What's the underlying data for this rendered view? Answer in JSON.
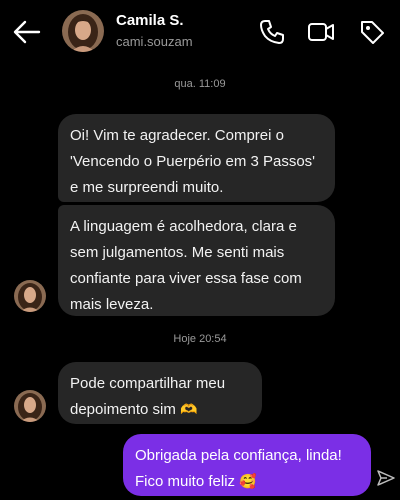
{
  "header": {
    "contact_name": "Camila S.",
    "username": "cami.souzam",
    "icons": [
      "back-arrow-icon",
      "phone-icon",
      "video-icon",
      "tag-icon"
    ]
  },
  "conversation": {
    "timestamp_1": "qua. 11:09",
    "messages_1": [
      {
        "from": "contact",
        "text": "Oi! Vim te agradecer. Comprei o 'Vencendo o Puerpério em 3 Passos' e me surpreendi muito."
      },
      {
        "from": "contact",
        "text": "A linguagem é acolhedora, clara e sem julgamentos. Me senti mais confiante para viver essa fase com mais leveza."
      }
    ],
    "timestamp_2": "Hoje 20:54",
    "messages_2": [
      {
        "from": "contact",
        "text": "Pode compartilhar meu depoimento sim",
        "emoji": "🫶"
      },
      {
        "from": "me",
        "text": "Obrigada pela confiança, linda! Fico muito feliz",
        "emoji": "🥰"
      }
    ]
  },
  "colors": {
    "background": "#000000",
    "incoming_bubble": "#262626",
    "outgoing_bubble": "#7b2fe6",
    "muted_text": "#9a9a9a"
  }
}
